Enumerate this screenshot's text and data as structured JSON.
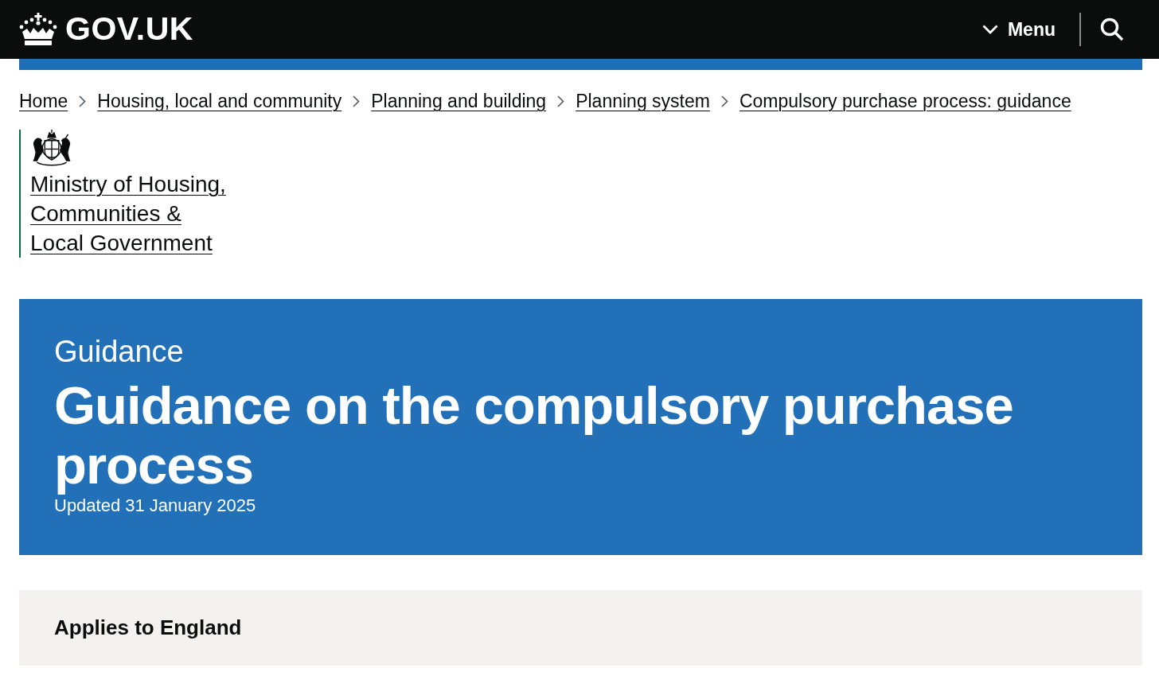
{
  "header": {
    "logo_text": "GOV.UK",
    "menu_button": "Menu"
  },
  "breadcrumbs": [
    "Home",
    "Housing, local and community",
    "Planning and building",
    "Planning system",
    "Compulsory purchase process: guidance"
  ],
  "organisation": {
    "name_lines": [
      "Ministry of Housing,",
      "Communities &",
      "Local Government"
    ]
  },
  "banner": {
    "caption": "Guidance",
    "title": "Guidance on the compulsory purchase process",
    "updated": "Updated 31 January 2025"
  },
  "applies_to": "Applies to England"
}
